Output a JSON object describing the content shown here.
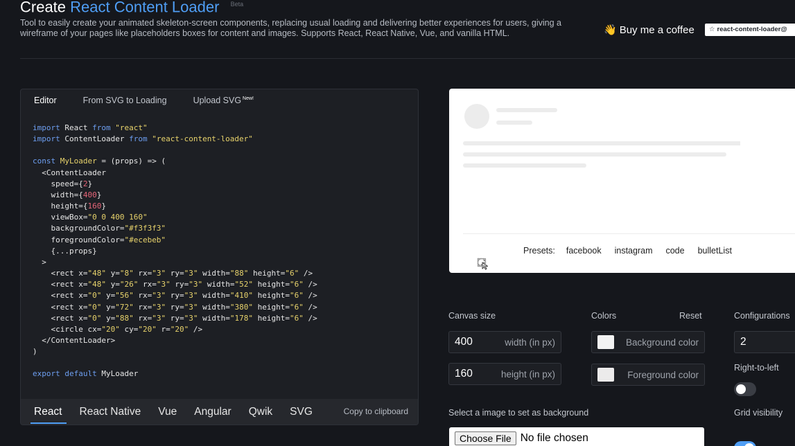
{
  "header": {
    "title_prefix": "Create",
    "title_accent": "React Content Loader",
    "title_badge": "Beta",
    "description": "Tool to easily create your animated skeleton-screen components, replacing usual loading and delivering better experiences for users, giving a wireframe of your pages like placeholders boxes for content and images. Supports React, React Native, Vue, and vanilla HTML.",
    "coffee_emoji": "👋",
    "coffee_label": "Buy me a coffee",
    "star_label": "react-content-loader@"
  },
  "editor": {
    "tabs": [
      {
        "label": "Editor"
      },
      {
        "label": "From SVG to Loading"
      },
      {
        "label": "Upload SVG",
        "badge": "New!"
      }
    ],
    "languages": [
      {
        "label": "React"
      },
      {
        "label": "React Native"
      },
      {
        "label": "Vue"
      },
      {
        "label": "Angular"
      },
      {
        "label": "Qwik"
      },
      {
        "label": "SVG"
      }
    ],
    "copy_label": "Copy to clipboard"
  },
  "preview": {
    "presets_label": "Presets:",
    "presets": [
      "facebook",
      "instagram",
      "code",
      "bulletList"
    ]
  },
  "settings": {
    "canvas_size_label": "Canvas size",
    "width_value": "400",
    "width_unit": "width (in px)",
    "height_value": "160",
    "height_unit": "height (in px)",
    "colors_label": "Colors",
    "reset_label": "Reset",
    "background_color_label": "Background color",
    "foreground_color_label": "Foreground color",
    "background_color": "#f3f3f3",
    "foreground_color": "#ecebeb",
    "configurations_label": "Configurations",
    "speed_value": "2",
    "rtl_label": "Right-to-left",
    "rtl_enabled": false,
    "grid_label": "Grid visibility",
    "grid_enabled": true,
    "background_image_label": "Select a image to set as background",
    "file_button_label": "Choose File",
    "file_status": "No file chosen"
  },
  "colors": {
    "accent": "#4f9ef5",
    "toggle_on": "#4f9ef5",
    "toggle_off": "#3a3d44"
  }
}
